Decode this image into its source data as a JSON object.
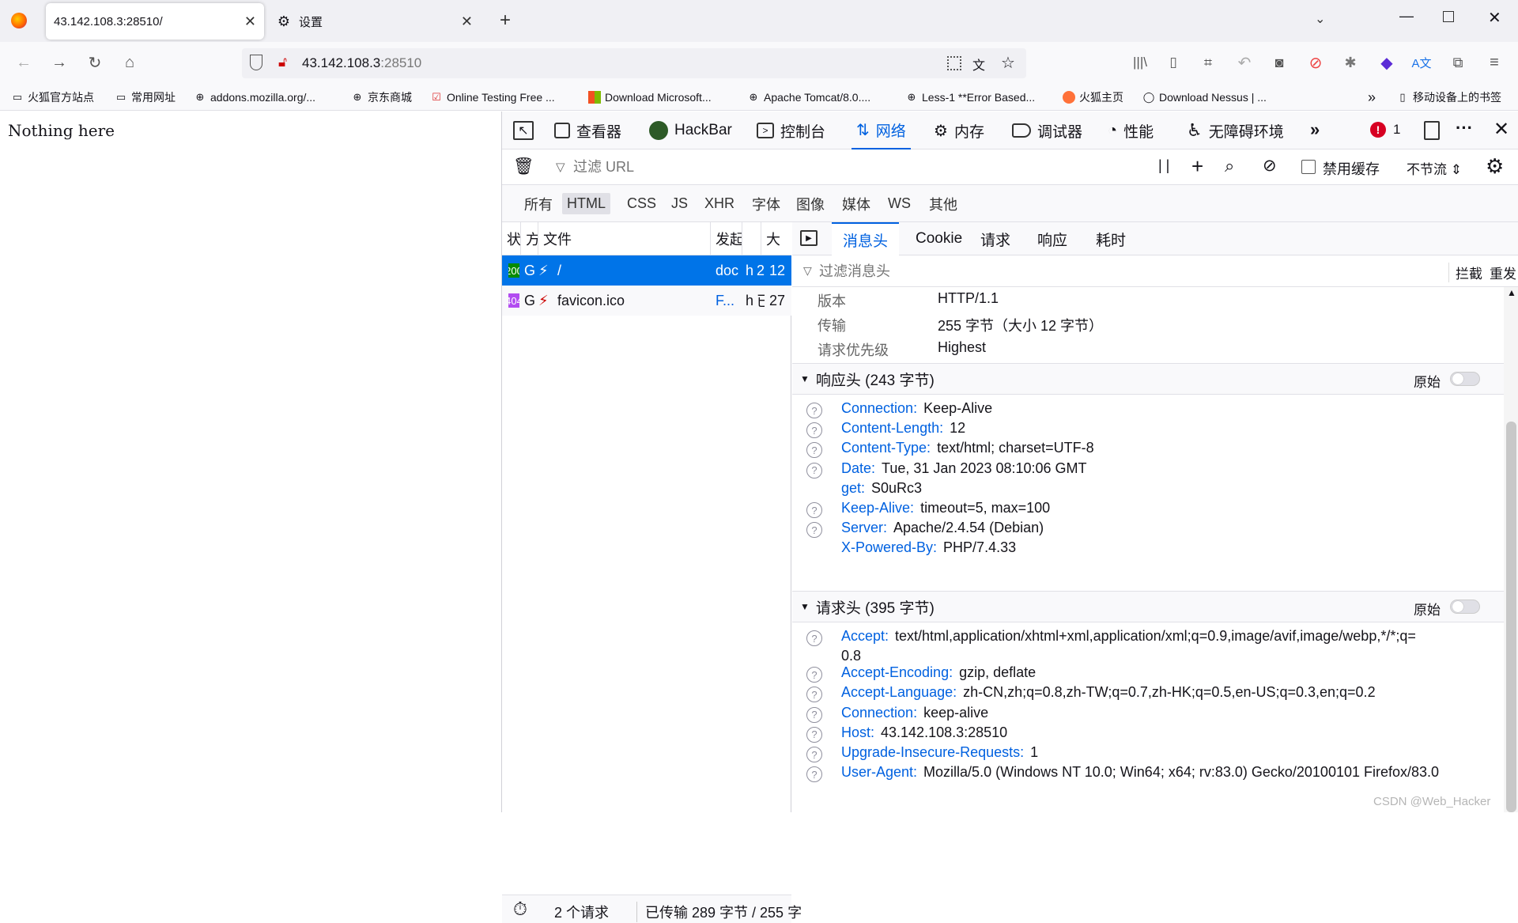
{
  "tabs": [
    {
      "title": "43.142.108.3:28510/",
      "active": true
    },
    {
      "title": "设置",
      "active": false
    }
  ],
  "url": {
    "host": "43.142.108.3",
    "port": ":28510"
  },
  "bookmarks": [
    {
      "label": "火狐官方站点",
      "icon": "folder-icon"
    },
    {
      "label": "常用网址",
      "icon": "folder-icon"
    },
    {
      "label": "addons.mozilla.org/...",
      "icon": "globe-icon"
    },
    {
      "label": "京东商城",
      "icon": "globe-icon"
    },
    {
      "label": "Online Testing Free ...",
      "icon": "checkmark-icon"
    },
    {
      "label": "Download Microsoft...",
      "icon": "microsoft-icon"
    },
    {
      "label": "Apache Tomcat/8.0....",
      "icon": "globe-icon"
    },
    {
      "label": "Less-1 **Error Based...",
      "icon": "globe-icon"
    },
    {
      "label": "火狐主页",
      "icon": "firefox-icon"
    },
    {
      "label": "Download Nessus | ...",
      "icon": "nessus-icon"
    }
  ],
  "bookmarks_overflow": "»",
  "mobile_bookmarks": "移动设备上的书签",
  "page": {
    "text": "Nothing here"
  },
  "devtools": {
    "tabs": [
      "查看器",
      "HackBar",
      "控制台",
      "网络",
      "内存",
      "调试器",
      "性能",
      "无障碍环境"
    ],
    "error_count": "1",
    "filter_placeholder": "过滤 URL",
    "disable_cache": "禁用缓存",
    "throttle": "不节流 ⇕",
    "types": [
      "所有",
      "HTML",
      "CSS",
      "JS",
      "XHR",
      "字体",
      "图像",
      "媒体",
      "WS",
      "其他"
    ],
    "columns": [
      "状",
      "方",
      "文件",
      "发起",
      "大"
    ],
    "requests": [
      {
        "status": "200",
        "method": "G",
        "file": "/",
        "initiator": "doc",
        "type": "h",
        "transferred": "2",
        "size": "12",
        "selected": true,
        "status_color": "#058b00"
      },
      {
        "status": "404",
        "method": "G",
        "file": "favicon.ico",
        "initiator": "F...",
        "type": "h",
        "transferred": "已",
        "size": "27",
        "selected": false,
        "status_color": "#b24cf1"
      }
    ],
    "summary": {
      "count": "2 个请求",
      "transferred": "已传输 289 字节 / 255 字"
    },
    "detail_tabs": [
      "消息头",
      "Cookie",
      "请求",
      "响应",
      "耗时"
    ],
    "header_filter": "过滤消息头",
    "block": "拦截",
    "resend": "重发",
    "summary_rows": [
      {
        "k": "版本",
        "v": "HTTP/1.1"
      },
      {
        "k": "传输",
        "v": "255 字节（大小 12 字节）"
      },
      {
        "k": "请求优先级",
        "v": "Highest"
      }
    ],
    "response_title": "响应头 (243 字节)",
    "raw": "原始",
    "response_headers": [
      {
        "k": "Connection:",
        "v": "Keep-Alive",
        "help": true
      },
      {
        "k": "Content-Length:",
        "v": "12",
        "help": true
      },
      {
        "k": "Content-Type:",
        "v": "text/html; charset=UTF-8",
        "help": true
      },
      {
        "k": "Date:",
        "v": "Tue, 31 Jan 2023 08:10:06 GMT",
        "help": true
      },
      {
        "k": "get:",
        "v": "S0uRc3",
        "help": false
      },
      {
        "k": "Keep-Alive:",
        "v": "timeout=5, max=100",
        "help": true
      },
      {
        "k": "Server:",
        "v": "Apache/2.4.54 (Debian)",
        "help": true
      },
      {
        "k": "X-Powered-By:",
        "v": "PHP/7.4.33",
        "help": false
      }
    ],
    "request_title": "请求头 (395 字节)",
    "request_headers": [
      {
        "k": "Accept:",
        "v": "text/html,application/xhtml+xml,application/xml;q=0.9,image/avif,image/webp,*/*;q=",
        "v2": "0.8",
        "help": true
      },
      {
        "k": "Accept-Encoding:",
        "v": "gzip, deflate",
        "help": true
      },
      {
        "k": "Accept-Language:",
        "v": "zh-CN,zh;q=0.8,zh-TW;q=0.7,zh-HK;q=0.5,en-US;q=0.3,en;q=0.2",
        "help": true
      },
      {
        "k": "Connection:",
        "v": "keep-alive",
        "help": true
      },
      {
        "k": "Host:",
        "v": "43.142.108.3:28510",
        "help": true
      },
      {
        "k": "Upgrade-Insecure-Requests:",
        "v": "1",
        "help": true
      },
      {
        "k": "User-Agent:",
        "v": "Mozilla/5.0 (Windows NT 10.0; Win64; x64; rv:83.0) Gecko/20100101 Firefox/83.0",
        "help": true
      }
    ],
    "watermark": "CSDN @Web_Hacker"
  }
}
